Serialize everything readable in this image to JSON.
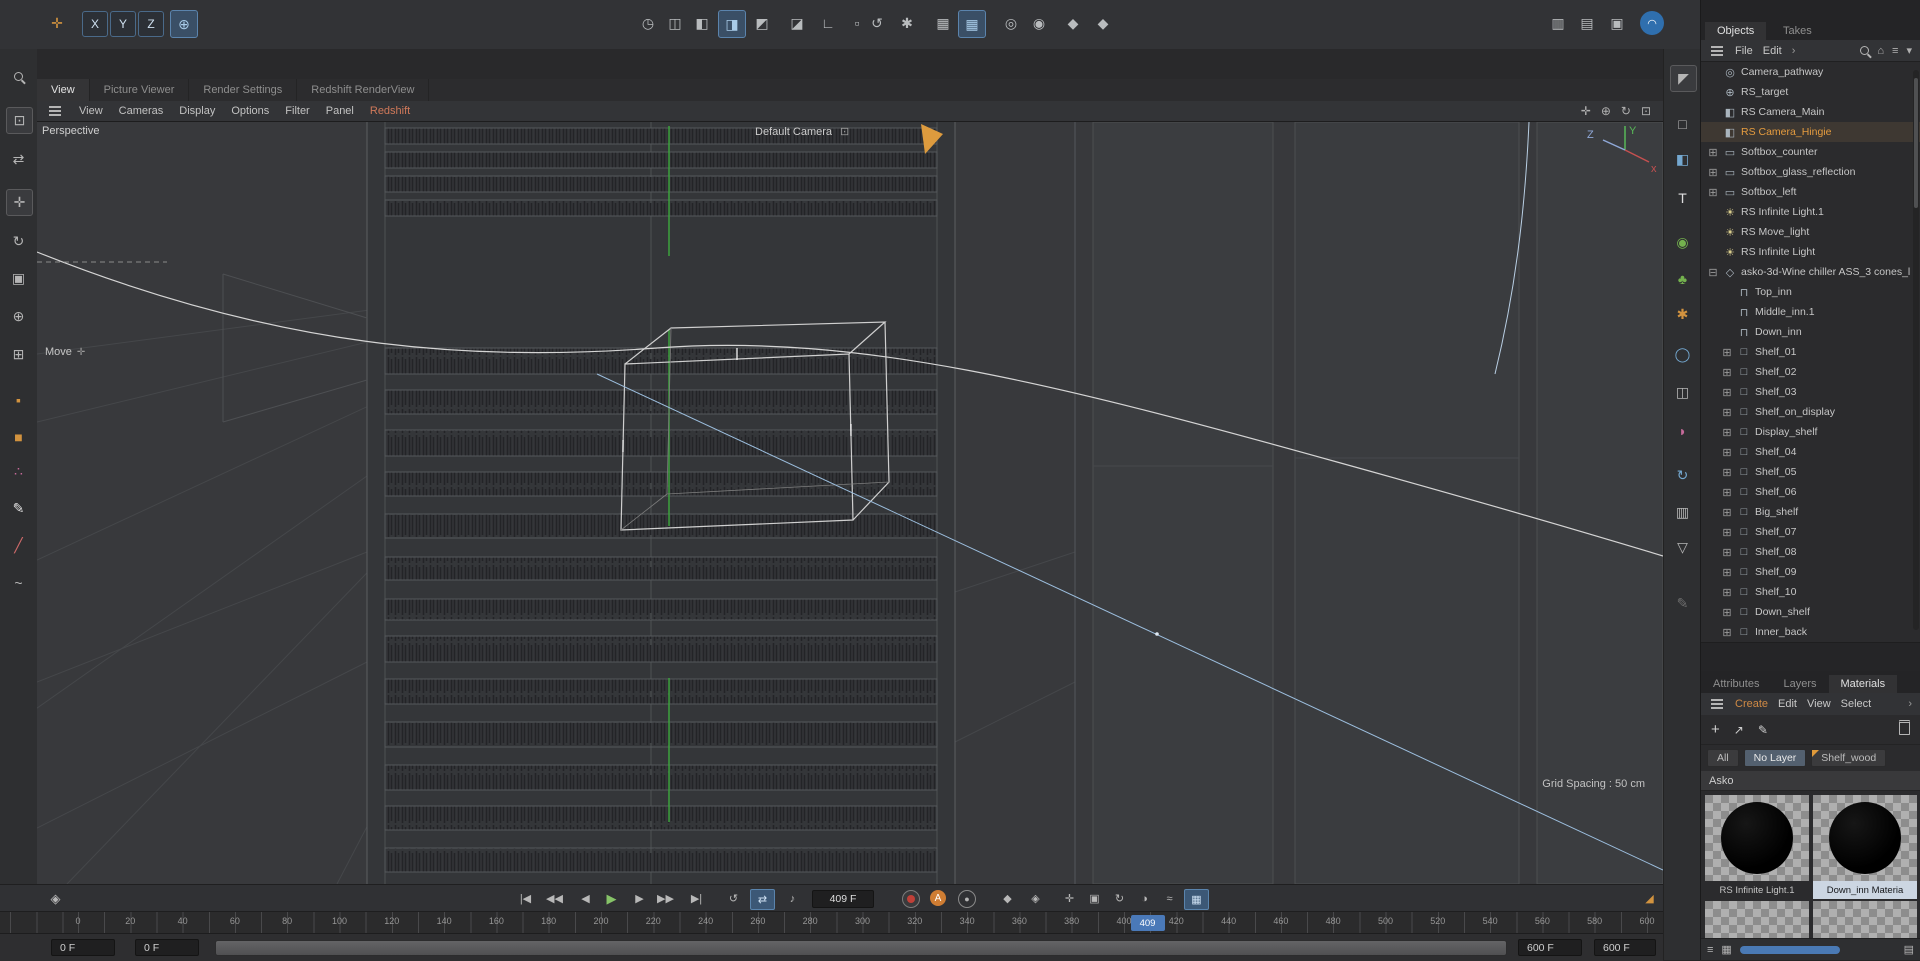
{
  "colors": {
    "accent_orange": "#e59c3f",
    "accent_blue": "#4a79b8",
    "viewport_bg": "#38393c",
    "green_axis": "#3da23d",
    "target_line_blue": "#9cbede"
  },
  "top_toolbar": {
    "axis_buttons": [
      "X",
      "Y",
      "Z"
    ],
    "left_icons": [
      "coordinate-system-icon",
      "world-coordinate-icon"
    ],
    "center_icons": [
      "render-view-icon",
      "render-region-icon",
      "render-settings-icon",
      "shading-mode-icon",
      "display-mode-icon",
      "camera-mode-icon",
      "axis-lock-icon",
      "workplane-icon",
      "reset-psr-icon",
      "gear-icon",
      "grid-toggle-icon",
      "snap-toggle-icon",
      "rotate-band-icon",
      "sphere-icon",
      "asset-badge-icon-1",
      "asset-badge-icon-2"
    ],
    "right_icons": [
      "dual-monitor-icon",
      "layout-icon",
      "save-layout-icon",
      "capsule-icon"
    ]
  },
  "left_toolbar": {
    "icons": [
      "magnify-tool-icon",
      "selection-tool-icon",
      "tweak-tool-icon",
      "move-tool-icon",
      "rotate-tool-icon",
      "scale-tool-icon",
      "axis-modify-icon",
      "model-mode-icon",
      "magnet-tool-icon",
      "plane-tool-icon",
      "paint-tool-icon",
      "brush-tool-icon",
      "knife-tool-icon",
      "spline-pen-icon"
    ]
  },
  "right_toolbar": {
    "icons": [
      "arrow-select-icon",
      "plane-primitive-icon",
      "cube-primitive-icon",
      "text-primitive-icon",
      "sphere-grid-icon",
      "tree-icon",
      "gear-icon",
      "torus-icon",
      "extrude-icon",
      "deformer-icon",
      "rotation-icon",
      "camera-icon",
      "filter-icon",
      "pen-icon"
    ]
  },
  "viewport": {
    "tabs": [
      {
        "label": "View",
        "active": true
      },
      {
        "label": "Picture Viewer",
        "active": false
      },
      {
        "label": "Render Settings",
        "active": false
      },
      {
        "label": "Redshift RenderView",
        "active": false
      }
    ],
    "menu_items": [
      "View",
      "Cameras",
      "Display",
      "Options",
      "Filter",
      "Panel",
      "Redshift"
    ],
    "nav_icons": [
      "pan-icon",
      "dolly-icon",
      "rotate-view-icon",
      "maximize-icon"
    ],
    "view_label": "Perspective",
    "camera_label": "Default Camera",
    "tool_label": "Move",
    "grid_spacing_label": "Grid Spacing : 50 cm",
    "axis_labels": {
      "x": "x",
      "y": "Y",
      "z": "Z"
    }
  },
  "object_manager": {
    "tabs": [
      "Objects",
      "Takes"
    ],
    "menu_items": [
      "File",
      "Edit"
    ],
    "header_icons": [
      "search-icon",
      "home-icon",
      "list-icon",
      "filter-icon"
    ],
    "items": [
      {
        "label": "Camera_pathway",
        "depth": 0,
        "icon": "camera-path-icon",
        "expand": ""
      },
      {
        "label": "RS_target",
        "depth": 0,
        "icon": "target-icon",
        "expand": ""
      },
      {
        "label": "RS Camera_Main",
        "depth": 0,
        "icon": "camera-icon",
        "expand": ""
      },
      {
        "label": "RS Camera_Hingie",
        "depth": 0,
        "icon": "camera-icon",
        "expand": "",
        "selected": true
      },
      {
        "label": "Softbox_counter",
        "depth": 0,
        "icon": "plane-icon",
        "expand": "plus"
      },
      {
        "label": "Softbox_glass_reflection",
        "depth": 0,
        "icon": "plane-icon",
        "expand": "plus"
      },
      {
        "label": "Softbox_left",
        "depth": 0,
        "icon": "plane-icon",
        "expand": "plus"
      },
      {
        "label": "RS Infinite Light.1",
        "depth": 0,
        "icon": "light-icon",
        "expand": ""
      },
      {
        "label": "RS Move_light",
        "depth": 0,
        "icon": "light-icon",
        "expand": ""
      },
      {
        "label": "RS Infinite Light",
        "depth": 0,
        "icon": "light-icon",
        "expand": ""
      },
      {
        "label": "asko-3d-Wine chiller ASS_3 cones_l",
        "depth": 0,
        "icon": "null-icon",
        "expand": "minus"
      },
      {
        "label": "Top_inn",
        "depth": 1,
        "icon": "polygon-icon",
        "expand": ""
      },
      {
        "label": "Middle_inn.1",
        "depth": 1,
        "icon": "polygon-icon",
        "expand": ""
      },
      {
        "label": "Down_inn",
        "depth": 1,
        "icon": "polygon-icon",
        "expand": ""
      },
      {
        "label": "Shelf_01",
        "depth": 1,
        "icon": "cube-icon",
        "expand": "plus"
      },
      {
        "label": "Shelf_02",
        "depth": 1,
        "icon": "cube-icon",
        "expand": "plus"
      },
      {
        "label": "Shelf_03",
        "depth": 1,
        "icon": "cube-icon",
        "expand": "plus"
      },
      {
        "label": "Shelf_on_display",
        "depth": 1,
        "icon": "cube-icon",
        "expand": "plus"
      },
      {
        "label": "Display_shelf",
        "depth": 1,
        "icon": "cube-icon",
        "expand": "plus"
      },
      {
        "label": "Shelf_04",
        "depth": 1,
        "icon": "cube-icon",
        "expand": "plus"
      },
      {
        "label": "Shelf_05",
        "depth": 1,
        "icon": "cube-icon",
        "expand": "plus"
      },
      {
        "label": "Shelf_06",
        "depth": 1,
        "icon": "cube-icon",
        "expand": "plus"
      },
      {
        "label": "Big_shelf",
        "depth": 1,
        "icon": "cube-icon",
        "expand": "plus"
      },
      {
        "label": "Shelf_07",
        "depth": 1,
        "icon": "cube-icon",
        "expand": "plus"
      },
      {
        "label": "Shelf_08",
        "depth": 1,
        "icon": "cube-icon",
        "expand": "plus"
      },
      {
        "label": "Shelf_09",
        "depth": 1,
        "icon": "cube-icon",
        "expand": "plus"
      },
      {
        "label": "Shelf_10",
        "depth": 1,
        "icon": "cube-icon",
        "expand": "plus"
      },
      {
        "label": "Down_shelf",
        "depth": 1,
        "icon": "cube-icon",
        "expand": "plus"
      },
      {
        "label": "Inner_back",
        "depth": 1,
        "icon": "cube-icon",
        "expand": "plus"
      }
    ]
  },
  "materials_panel": {
    "tabs": [
      {
        "label": "Attributes",
        "active": false
      },
      {
        "label": "Layers",
        "active": false
      },
      {
        "label": "Materials",
        "active": true
      }
    ],
    "menu_items": [
      "Create",
      "Edit",
      "View",
      "Select"
    ],
    "toolbar_icons": [
      "add-icon",
      "apply-arrow-icon",
      "eyedropper-icon",
      "trash-icon"
    ],
    "filters": [
      {
        "label": "All",
        "selected": false,
        "color_tag": false
      },
      {
        "label": "No Layer",
        "selected": true,
        "color_tag": false
      },
      {
        "label": "Shelf_wood",
        "selected": false,
        "color_tag": true
      }
    ],
    "group_label": "Asko",
    "materials": [
      {
        "name": "RS Infinite Light.1",
        "selected": false
      },
      {
        "name": "Down_inn Materia",
        "selected": true
      }
    ],
    "bottom_icons": [
      "list-view-icon",
      "grid-view-icon",
      "detail-view-icon"
    ]
  },
  "timeline": {
    "transport_icons": [
      "jump-start-button",
      "prev-key-button",
      "prev-frame-button",
      "play-button",
      "next-frame-button",
      "next-key-button",
      "jump-end-button",
      "loop-button",
      "ramp-button",
      "sound-button"
    ],
    "record_icons": [
      "record-button",
      "autokey-button",
      "keyframe-ring-button",
      "key-diamond-button",
      "key-diamond2-button",
      "record-position-icon",
      "record-scale-icon",
      "record-rotation-icon",
      "record-parameter-icon",
      "record-pla-icon",
      "snap-key-button"
    ],
    "frame_value": "409 F",
    "current_frame": 409,
    "frame_start": 0,
    "frame_end": 600,
    "tick_step": 20,
    "playhead_label": "409",
    "range_fields": {
      "start_1": "0 F",
      "start_2": "0 F",
      "end_1": "600 F",
      "end_2": "600 F"
    }
  }
}
